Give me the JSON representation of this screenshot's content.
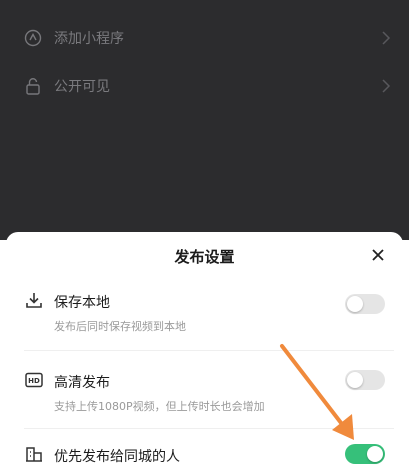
{
  "background_menu": {
    "items": [
      {
        "label": "添加小程序",
        "icon": "mini-program-icon"
      },
      {
        "label": "公开可见",
        "icon": "unlock-icon"
      }
    ]
  },
  "sheet": {
    "title": "发布设置",
    "close_icon": "close-icon",
    "options": [
      {
        "title": "保存本地",
        "description": "发布后同时保存视频到本地",
        "icon": "download-icon",
        "enabled": false
      },
      {
        "title": "高清发布",
        "description": "支持上传1080P视频，但上传时长也会增加",
        "icon": "hd-icon",
        "enabled": false
      },
      {
        "title": "优先发布给同城的人",
        "icon": "local-city-icon",
        "enabled": true
      }
    ]
  },
  "colors": {
    "dark_background": "#2c2c2e",
    "toggle_on": "#36c07a",
    "toggle_off": "#e5e5e5",
    "annotation_arrow": "#f08a3c"
  }
}
